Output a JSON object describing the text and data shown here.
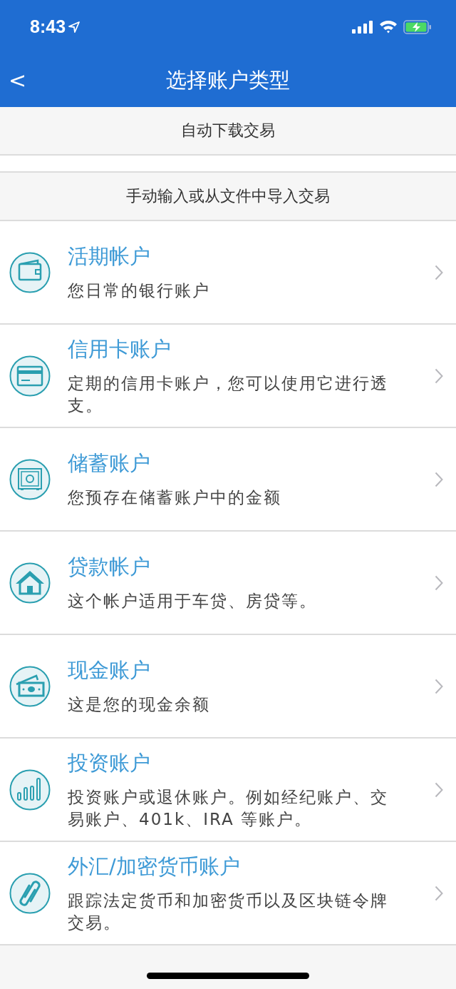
{
  "status_bar": {
    "time": "8:43"
  },
  "nav_bar": {
    "title": "选择账户类型",
    "back": "<"
  },
  "sections": [
    {
      "header": "自动下载交易"
    },
    {
      "header": "手动输入或从文件中导入交易",
      "items": [
        {
          "title": "活期帐户",
          "description": "您日常的银行账户"
        },
        {
          "title": "信用卡账户",
          "description": "定期的信用卡账户，您可以使用它进行透支。"
        },
        {
          "title": "储蓄账户",
          "description": "您预存在储蓄账户中的金额"
        },
        {
          "title": "贷款帐户",
          "description": "这个帐户适用于车贷、房贷等。"
        },
        {
          "title": "现金账户",
          "description": "这是您的现金余额"
        },
        {
          "title": "投资账户",
          "description": "投资账户或退休账户。例如经纪账户、交易账户、401k、IRA 等账户。"
        },
        {
          "title": "外汇/加密货币账户",
          "description": "跟踪法定货币和加密货币以及区块链令牌交易。"
        }
      ]
    }
  ]
}
